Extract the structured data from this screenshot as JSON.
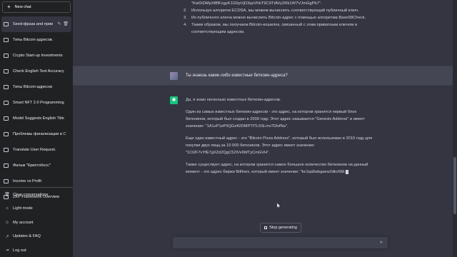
{
  "sidebar": {
    "new_chat": "New chat",
    "chats": [
      {
        "label": "Seed-фраза and прив",
        "active": true
      },
      {
        "label": "Типы Bitcoin адресов.",
        "active": false
      },
      {
        "label": "Crypto Start-up Investments",
        "active": false
      },
      {
        "label": "Check English Text Accuracy",
        "active": false
      },
      {
        "label": "Типы Bitcoin-адресов",
        "active": false
      },
      {
        "label": "Smart NFT 2.0 Programming",
        "active": false
      },
      {
        "label": "Model Suggests English Title",
        "active": false
      },
      {
        "label": "Проблемы финализации в С",
        "active": false
      },
      {
        "label": "Translate User Request.",
        "active": false
      },
      {
        "label": "Фильм \"Криптобосс\"",
        "active": false
      },
      {
        "label": "Income vs Profit",
        "active": false
      },
      {
        "label": "ZKP Framework Overview",
        "active": false
      }
    ],
    "bottom": [
      {
        "label": "Clear conversations",
        "icon": "trash-icon"
      },
      {
        "label": "Light mode",
        "icon": "sun-icon"
      },
      {
        "label": "My account",
        "icon": "user-icon"
      },
      {
        "label": "Updates & FAQ",
        "icon": "external-link-icon"
      },
      {
        "label": "Log out",
        "icon": "logout-icon"
      }
    ]
  },
  "conversation": {
    "prev_list": [
      {
        "num": "",
        "text": "\"KwDiDMpXf8fFzgyK1G5pVjD3qzVhbT9C9TtAVy2Rk1W7VJmGgPb7\"."
      },
      {
        "num": "2.",
        "text": "Используя алгоритм ECDSA, мы можем вычислить соответствующий публичный ключ."
      },
      {
        "num": "3.",
        "text": "Из публичного ключа можно вычислить Bitcoin-адрес с помощью алгоритма Base58Check."
      },
      {
        "num": "4.",
        "text": "Таким образом, мы получаем Bitcoin-кошелек, связанный с этим приватным ключом и соответствующим адресом."
      }
    ],
    "user_message": "Ты знаешь какие-либо известные биткоин-адреса?",
    "answer": [
      "Да, я знаю несколько известных биткоин-адресов.",
      "Один из самых известных биткоин-адресов - это адрес, на котором хранится первый блок биткоинов, который был создан в 2009 году. Этот адрес называется \"Genesis Address\" и имеет значение: \"1A1zP1eP5QGefi2DMPTfTL5SLmv7DivfNa\".",
      "Еще один известный адрес - это \"Bitcoin Pizza Address\", который был использован в 2010 году для покупки двух пицц за 10 000 биткоинов. Этот адрес имеет значение: \"1Ct2F7vYfE7gXZd2QgC52iVv6WTyCmGVH\".",
      "Также существует адрес, на котором хранится самое большое количество биткоинов на данный момент - это адрес биржи Bitfinex, который имеет значение: \"bc1qa5wkgaew2dkv56k"
    ]
  },
  "controls": {
    "stop_label": "Stop generating",
    "input_value": "",
    "input_placeholder": ""
  },
  "colors": {
    "sidebar_bg": "#202123",
    "main_bg": "#343541",
    "user_row_bg": "#444654",
    "assistant_avatar": "#19c37d"
  }
}
